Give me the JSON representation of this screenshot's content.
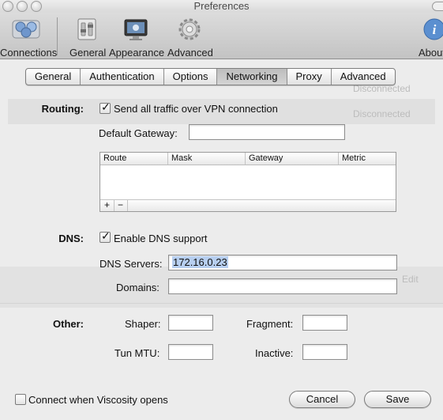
{
  "window": {
    "title": "Preferences"
  },
  "toolbar": {
    "items": [
      {
        "label": "Connections",
        "icon": "network-globe-icon"
      },
      {
        "label": "General",
        "icon": "settings-switch-icon"
      },
      {
        "label": "Appearance",
        "icon": "display-icon"
      },
      {
        "label": "Advanced",
        "icon": "gear-icon"
      },
      {
        "label": "About",
        "icon": "info-icon"
      }
    ]
  },
  "tabs": [
    {
      "label": "General",
      "selected": false
    },
    {
      "label": "Authentication",
      "selected": false
    },
    {
      "label": "Options",
      "selected": false
    },
    {
      "label": "Networking",
      "selected": true
    },
    {
      "label": "Proxy",
      "selected": false
    },
    {
      "label": "Advanced",
      "selected": false
    }
  ],
  "background": {
    "status_1": "Disconnected",
    "status_2": "Disconnected",
    "edit": "Edit"
  },
  "routing": {
    "label": "Routing:",
    "send_all_label": "Send all traffic over VPN connection",
    "send_all_checked": true,
    "default_gateway_label": "Default Gateway:",
    "default_gateway_value": "",
    "table_headers": [
      "Route",
      "Mask",
      "Gateway",
      "Metric"
    ],
    "add_label": "+",
    "remove_label": "−"
  },
  "dns": {
    "label": "DNS:",
    "enable_label": "Enable DNS support",
    "enable_checked": true,
    "servers_label": "DNS Servers:",
    "servers_value": "172.16.0.23",
    "domains_label": "Domains:",
    "domains_value": ""
  },
  "other": {
    "label": "Other:",
    "shaper_label": "Shaper:",
    "shaper_value": "",
    "fragment_label": "Fragment:",
    "fragment_value": "",
    "tun_mtu_label": "Tun MTU:",
    "tun_mtu_value": "",
    "inactive_label": "Inactive:",
    "inactive_value": ""
  },
  "footer": {
    "connect_label": "Connect when Viscosity opens",
    "connect_checked": false,
    "cancel_label": "Cancel",
    "save_label": "Save"
  },
  "colors": {
    "accent": "#3d7fd6",
    "selection": "#b7cff0"
  }
}
